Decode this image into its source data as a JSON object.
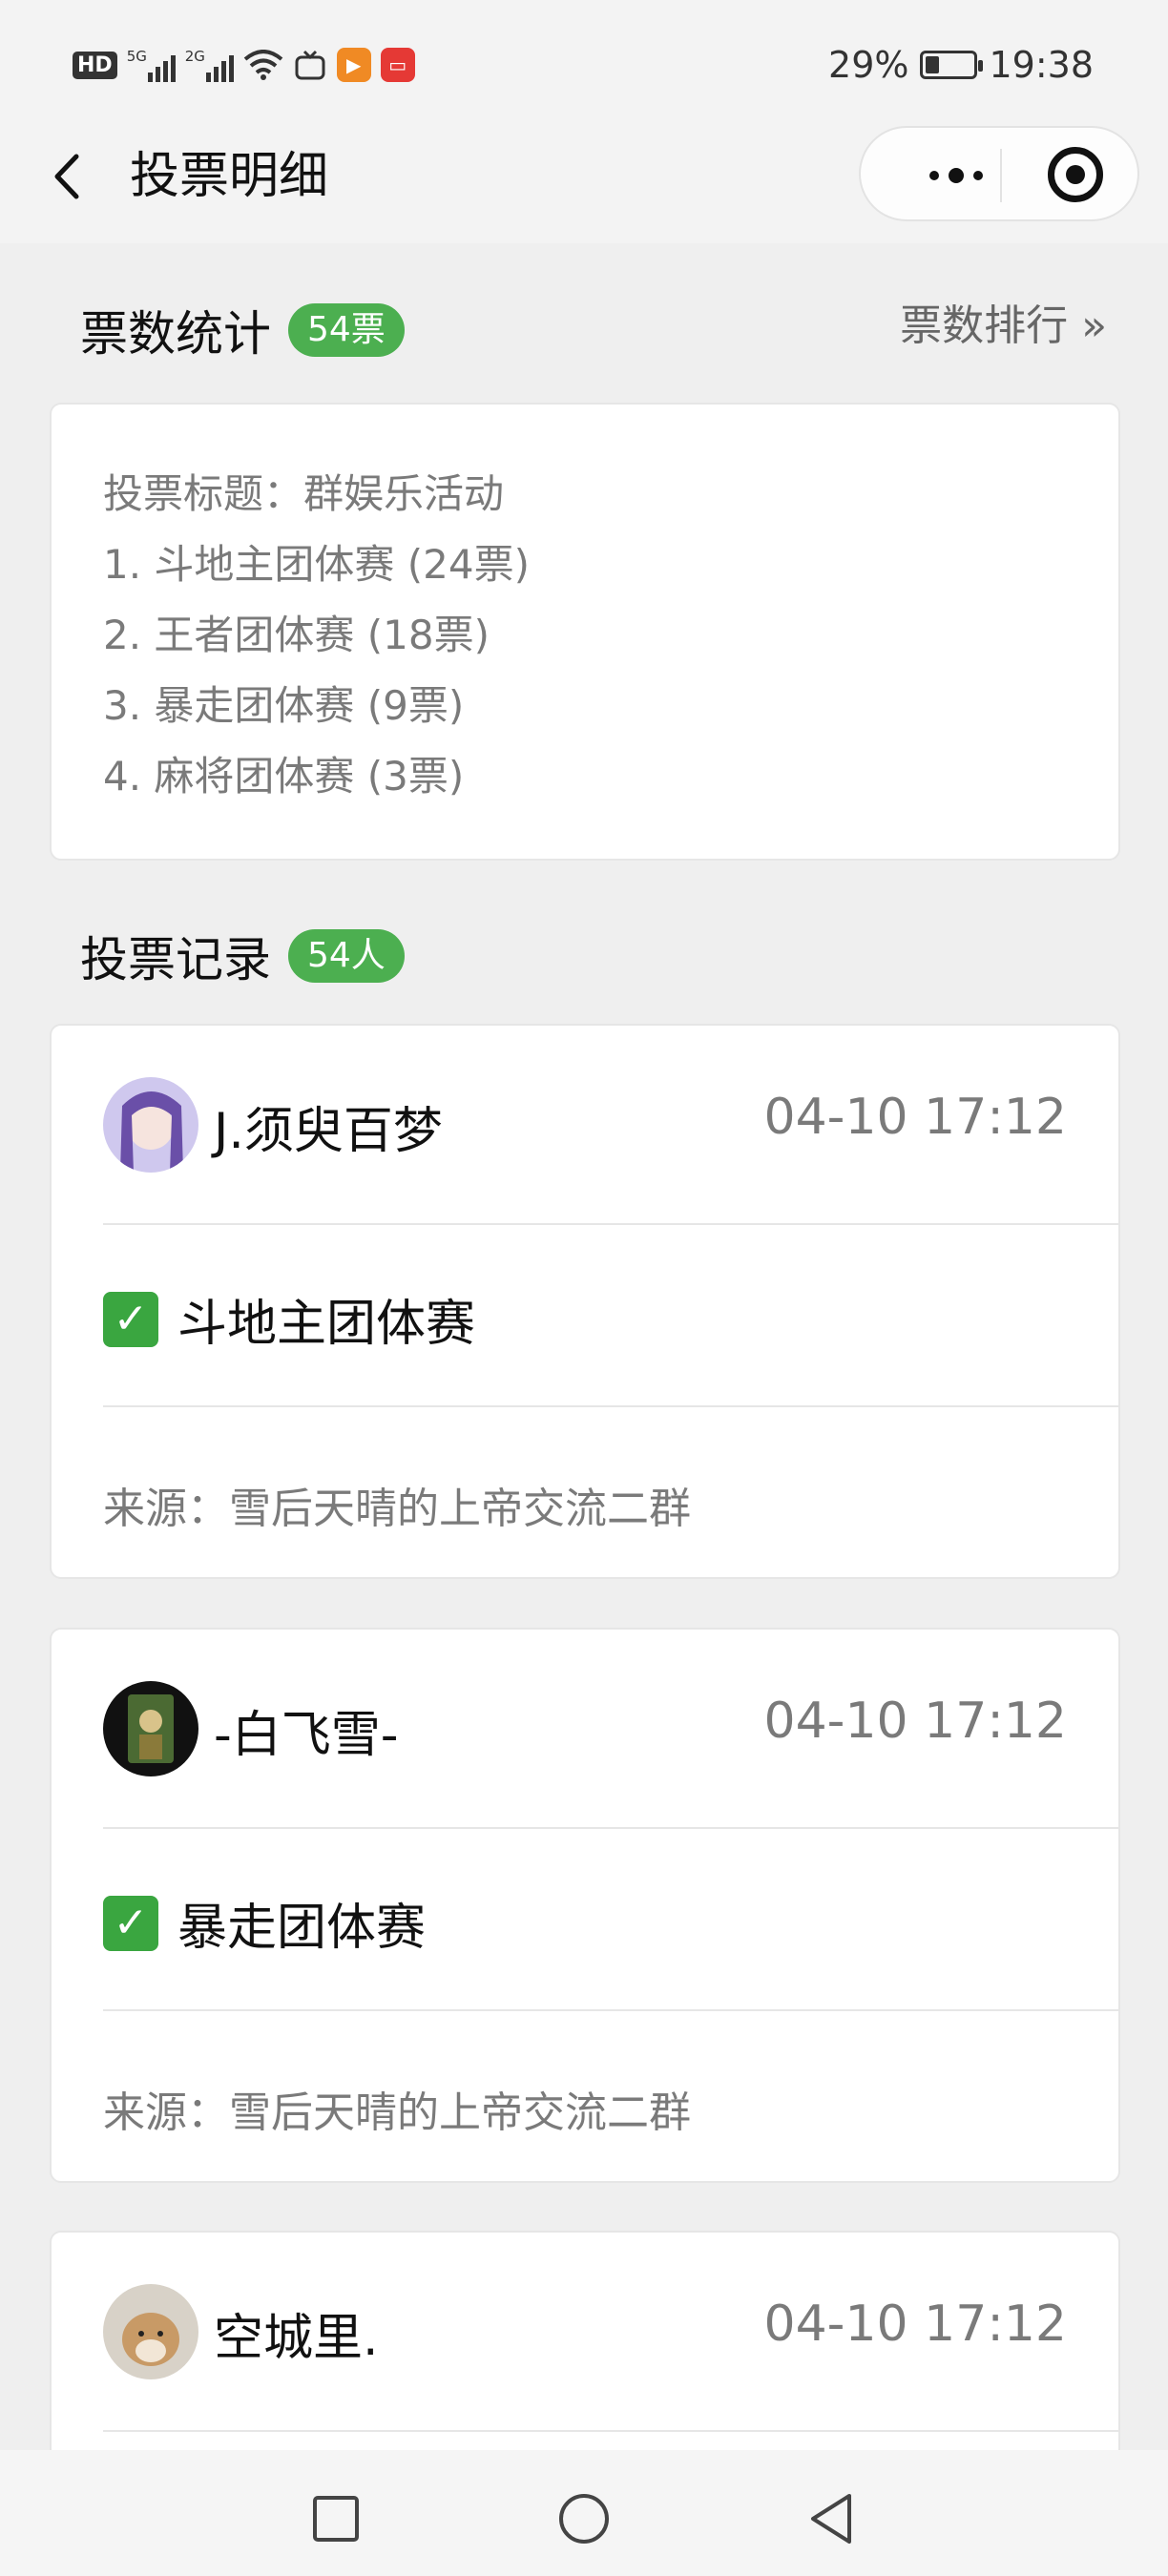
{
  "status_bar": {
    "hd": "HD",
    "sim1": "5G",
    "sim2": "2G",
    "battery": "29%",
    "battery_level": 0.29,
    "time": "19:38"
  },
  "nav": {
    "title": "投票明细",
    "icons": [
      "back-icon",
      "more-icon",
      "target-icon"
    ]
  },
  "stats": {
    "title": "票数统计",
    "badge": "54票",
    "rank_link": "票数排行 »",
    "vote_title": "投票标题：群娱乐活动",
    "options": [
      "1. 斗地主团体赛 (24票)",
      "2. 王者团体赛 (18票)",
      "3. 暴走团体赛 (9票)",
      "4. 麻将团体赛 (3票)"
    ]
  },
  "records_section": {
    "title": "投票记录",
    "badge": "54人"
  },
  "records": [
    {
      "name": "J.须臾百梦",
      "time": "04-10 17:12",
      "choice": "斗地主团体赛",
      "source": "来源：雪后天晴的上帝交流二群",
      "avatar_color": "#8f7fc7"
    },
    {
      "name": "-白飞雪-",
      "time": "04-10 17:12",
      "choice": "暴走团体赛",
      "source": "来源：雪后天晴的上帝交流二群",
      "avatar_color": "#3e5a2d"
    },
    {
      "name": "空城里.",
      "time": "04-10 17:12",
      "avatar_color": "#c89a66"
    }
  ],
  "check_mark": "✓",
  "bottom_nav": [
    "square-icon",
    "circle-icon",
    "back-triangle-icon"
  ]
}
